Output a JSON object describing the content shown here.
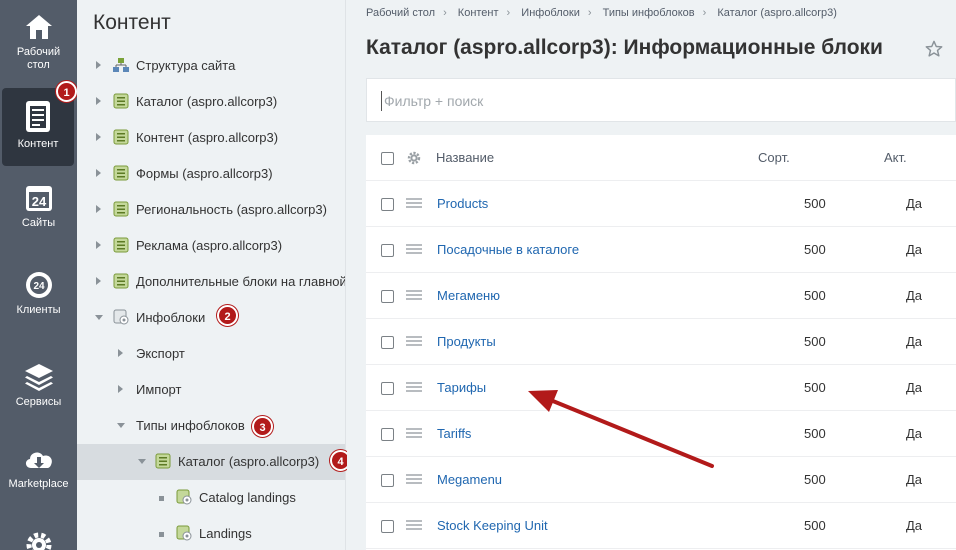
{
  "rail": {
    "desktop": "Рабочий стол",
    "content": "Контент",
    "sites": "Сайты",
    "clients": "Клиенты",
    "services": "Сервисы",
    "marketplace": "Marketplace",
    "sites_icon_text": "24",
    "clients_icon_text": "24"
  },
  "badges": [
    "1",
    "2",
    "3",
    "4"
  ],
  "tree": {
    "title": "Контент",
    "items": [
      {
        "label": "Структура сайта"
      },
      {
        "label": "Каталог (aspro.allcorp3)"
      },
      {
        "label": "Контент (aspro.allcorp3)"
      },
      {
        "label": "Формы (aspro.allcorp3)"
      },
      {
        "label": "Региональность (aspro.allcorp3)"
      },
      {
        "label": "Реклама (aspro.allcorp3)"
      },
      {
        "label": "Дополнительные блоки на главной"
      },
      {
        "label": "Инфоблоки"
      },
      {
        "label": "Экспорт"
      },
      {
        "label": "Импорт"
      },
      {
        "label": "Типы инфоблоков"
      },
      {
        "label": "Каталог (aspro.allcorp3)"
      },
      {
        "label": "Catalog landings"
      },
      {
        "label": "Landings"
      }
    ]
  },
  "breadcrumbs": [
    "Рабочий стол",
    "Контент",
    "Инфоблоки",
    "Типы инфоблоков",
    "Каталог (aspro.allcorp3)"
  ],
  "page_title": "Каталог (aspro.allcorp3): Информационные блоки",
  "filter": {
    "placeholder": "Фильтр + поиск"
  },
  "grid": {
    "headers": {
      "name": "Название",
      "sort": "Сорт.",
      "active": "Акт."
    },
    "rows": [
      {
        "name": "Products",
        "sort": "500",
        "active": "Да"
      },
      {
        "name": "Посадочные в каталоге",
        "sort": "500",
        "active": "Да"
      },
      {
        "name": "Мегаменю",
        "sort": "500",
        "active": "Да"
      },
      {
        "name": "Продукты",
        "sort": "500",
        "active": "Да"
      },
      {
        "name": "Тарифы",
        "sort": "500",
        "active": "Да"
      },
      {
        "name": "Tariffs",
        "sort": "500",
        "active": "Да"
      },
      {
        "name": "Megamenu",
        "sort": "500",
        "active": "Да"
      },
      {
        "name": "Stock Keeping Unit",
        "sort": "500",
        "active": "Да"
      }
    ]
  },
  "colors": {
    "rail": "#535c69",
    "badge": "#b21a1a",
    "link": "#2067b0",
    "annotation_arrow": "#b21a1a"
  }
}
